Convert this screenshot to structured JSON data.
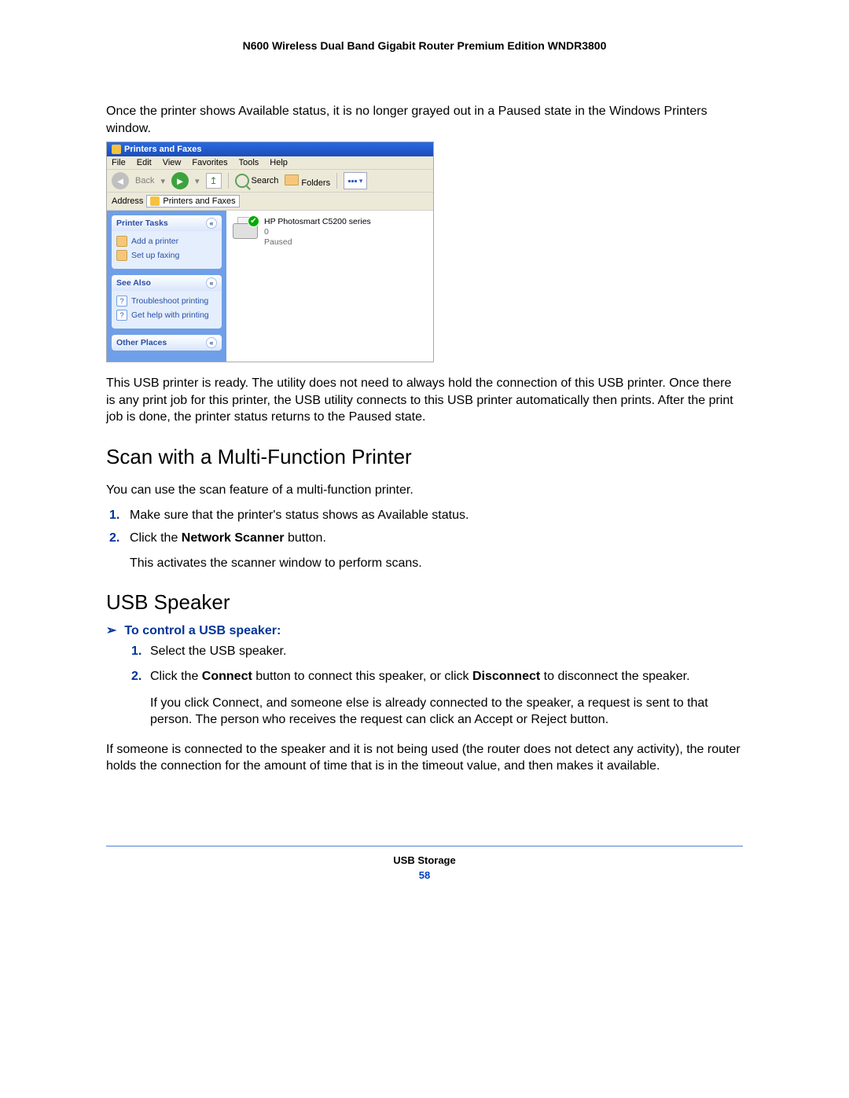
{
  "header": {
    "title": "N600 Wireless Dual Band Gigabit Router Premium Edition WNDR3800"
  },
  "intro": {
    "p1": "Once the printer shows Available status, it is no longer grayed out in a Paused state in the Windows Printers window."
  },
  "screenshot": {
    "titlebar": "Printers and Faxes",
    "menu": {
      "file": "File",
      "edit": "Edit",
      "view": "View",
      "favorites": "Favorites",
      "tools": "Tools",
      "help": "Help"
    },
    "toolbar": {
      "back": "Back",
      "search": "Search",
      "folders": "Folders"
    },
    "address": {
      "label": "Address",
      "value": "Printers and Faxes"
    },
    "sidebar": {
      "printerTasks": {
        "title": "Printer Tasks",
        "addPrinter": "Add a printer",
        "setupFax": "Set up faxing"
      },
      "seeAlso": {
        "title": "See Also",
        "troubleshoot": "Troubleshoot printing",
        "gethelp": "Get help with printing"
      },
      "otherPlaces": {
        "title": "Other Places"
      }
    },
    "printer": {
      "name": "HP Photosmart C5200 series",
      "jobs": "0",
      "status": "Paused"
    }
  },
  "para_after": "This USB printer is ready. The utility does not need to always hold the connection of this USB printer. Once there is any print job for this printer, the USB utility connects to this USB printer automatically then prints. After the print job is done, the printer status returns to the Paused state.",
  "scan": {
    "heading": "Scan with a Multi-Function Printer",
    "intro": "You can use the scan feature of a multi-function printer.",
    "step1": "Make sure that the printer's status shows as Available status.",
    "step2_a": "Click the ",
    "step2_b": "Network Scanner",
    "step2_c": " button.",
    "step2_sub": "This activates the scanner window to perform scans."
  },
  "usb": {
    "heading": "USB Speaker",
    "proc": "To control a USB speaker:",
    "s1": "Select the USB speaker.",
    "s2_a": "Click the ",
    "s2_b": "Connect",
    "s2_c": " button to connect this speaker, or click ",
    "s2_d": "Disconnect",
    "s2_e": " to disconnect the speaker.",
    "s2_sub": "If you click Connect, and someone else is already connected to the speaker, a request is sent to that person. The person who receives the request can click an Accept or Reject button.",
    "closing": "If someone is connected to the speaker and it is not being used (the router does not detect any activity), the router holds the connection for the amount of time that is in the timeout value, and then makes it available."
  },
  "footer": {
    "section": "USB Storage",
    "page": "58"
  }
}
